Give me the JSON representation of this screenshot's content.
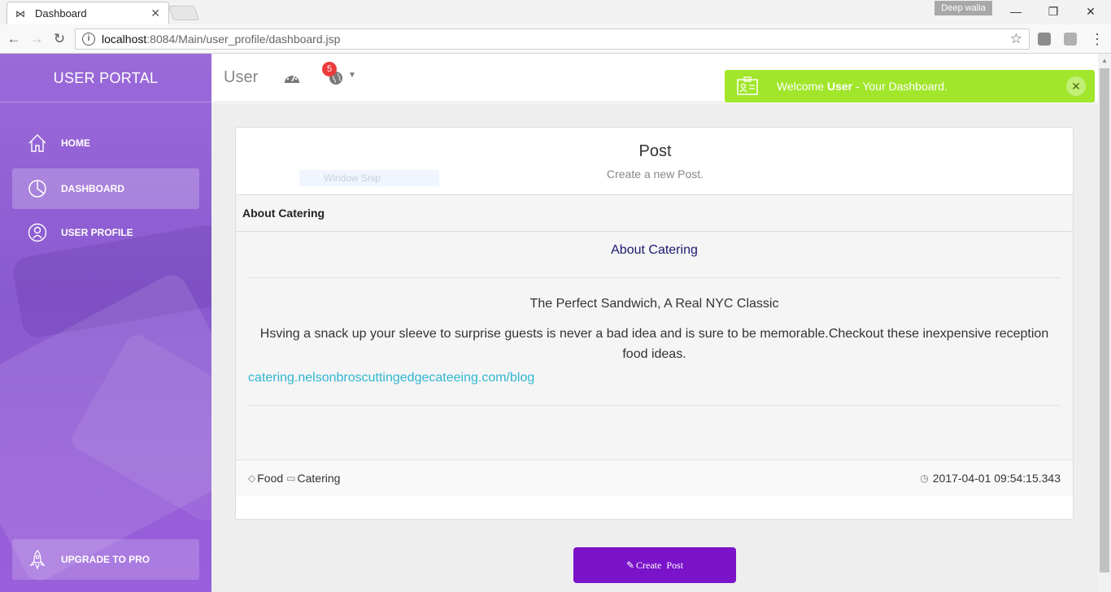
{
  "browser": {
    "tab_title": "Dashboard",
    "tab_close": "✕",
    "profile_name": "Deep walia",
    "url_host": "localhost",
    "url_rest": ":8084/Main/user_profile/dashboard.jsp",
    "controls": {
      "minimize": "—",
      "restore": "❐",
      "close": "✕"
    }
  },
  "sidebar": {
    "brand": "USER PORTAL",
    "items": [
      {
        "label": "HOME",
        "icon": "home-icon",
        "active": false
      },
      {
        "label": "DASHBOARD",
        "icon": "pie-chart-icon",
        "active": true
      },
      {
        "label": "USER PROFILE",
        "icon": "user-icon",
        "active": false
      }
    ],
    "upgrade_label": "UPGRADE TO PRO"
  },
  "header": {
    "title": "User",
    "notification_count": "5"
  },
  "notification": {
    "prefix": "Welcome ",
    "user": "User",
    "suffix": " - Your Dashboard.",
    "close": "✕",
    "color": "#a1e62b"
  },
  "card": {
    "title": "Post",
    "subtitle": "Create a new Post.",
    "overlay_text": "Window Snip",
    "panel_heading": "About Catering",
    "section_title": "About Catering",
    "headline": "The Perfect Sandwich, A Real NYC Classic",
    "body": "Hsving a snack up your sleeve to surprise guests is never a bad idea and is sure to be memorable.Checkout these inexpensive reception food ideas.",
    "link": "catering.nelsonbroscuttingedgecateeing.com/blog",
    "tags": [
      "Food",
      "Catering"
    ],
    "timestamp": "2017-04-01 09:54:15.343"
  },
  "actions": {
    "create_post": "Create  Post"
  },
  "colors": {
    "accent": "#7a13c9",
    "sidebar": "#9b6ad9",
    "link": "#2fb6d1",
    "badge": "#ec3a3a"
  }
}
